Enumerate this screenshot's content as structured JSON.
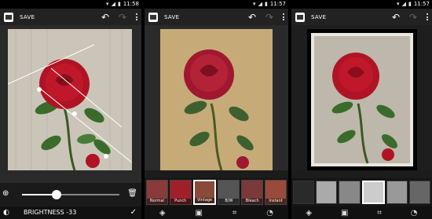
{
  "screens": [
    {
      "status": {
        "time": "11:58"
      },
      "actionbar": {
        "save_label": "SAVE"
      },
      "slider": {
        "value_fraction": 0.37
      },
      "label": "BRIGHTNESS -33"
    },
    {
      "status": {
        "time": "11:57"
      },
      "actionbar": {
        "save_label": "SAVE"
      },
      "filters": [
        {
          "label": "Normal"
        },
        {
          "label": "Punch"
        },
        {
          "label": "Vintage"
        },
        {
          "label": "B/W"
        },
        {
          "label": "Bleach"
        },
        {
          "label": "Instant"
        }
      ],
      "selected_filter": 2
    },
    {
      "status": {
        "time": "11:57"
      },
      "actionbar": {
        "save_label": "SAVE"
      }
    }
  ],
  "icons": {
    "undo": "undo-icon",
    "redo": "redo-icon",
    "overflow": "overflow-menu-icon",
    "effects": "effects-icon",
    "borders": "borders-icon",
    "crop": "crop-icon",
    "adjust": "adjust-icon",
    "confirm": "check-icon",
    "delete": "trash-icon"
  },
  "colors": {
    "background": "#1c1c1c",
    "actionbar": "#222222",
    "rose": "#c0182a",
    "leaf": "#3a6b2a"
  }
}
